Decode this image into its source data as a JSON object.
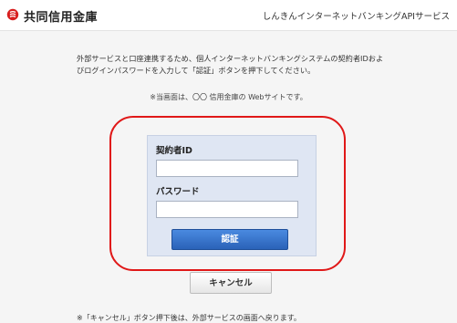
{
  "header": {
    "brand": "共同信用金庫",
    "service": "しんきんインターネットバンキングAPIサービス",
    "logo_color": "#d81e1e"
  },
  "intro": {
    "line1": "外部サービスと口座連携するため、個人インターネットバンキングシステムの契約者IDおよ",
    "line2": "びログインパスワードを入力して「認証」ボタンを押下してください。"
  },
  "notice": "※当画面は、〇〇 信用金庫の Webサイトです。",
  "form": {
    "contract_id_label": "契約者ID",
    "contract_id_value": "",
    "password_label": "パスワード",
    "password_value": "",
    "auth_button": "認証"
  },
  "cancel_button": "キャンセル",
  "footer_note": "※「キャンセル」ボタン押下後は、外部サービスの画面へ戻ります。",
  "colors": {
    "highlight": "#e01818",
    "auth_button": "#2f6cc4",
    "panel": "#dfe6f3"
  }
}
